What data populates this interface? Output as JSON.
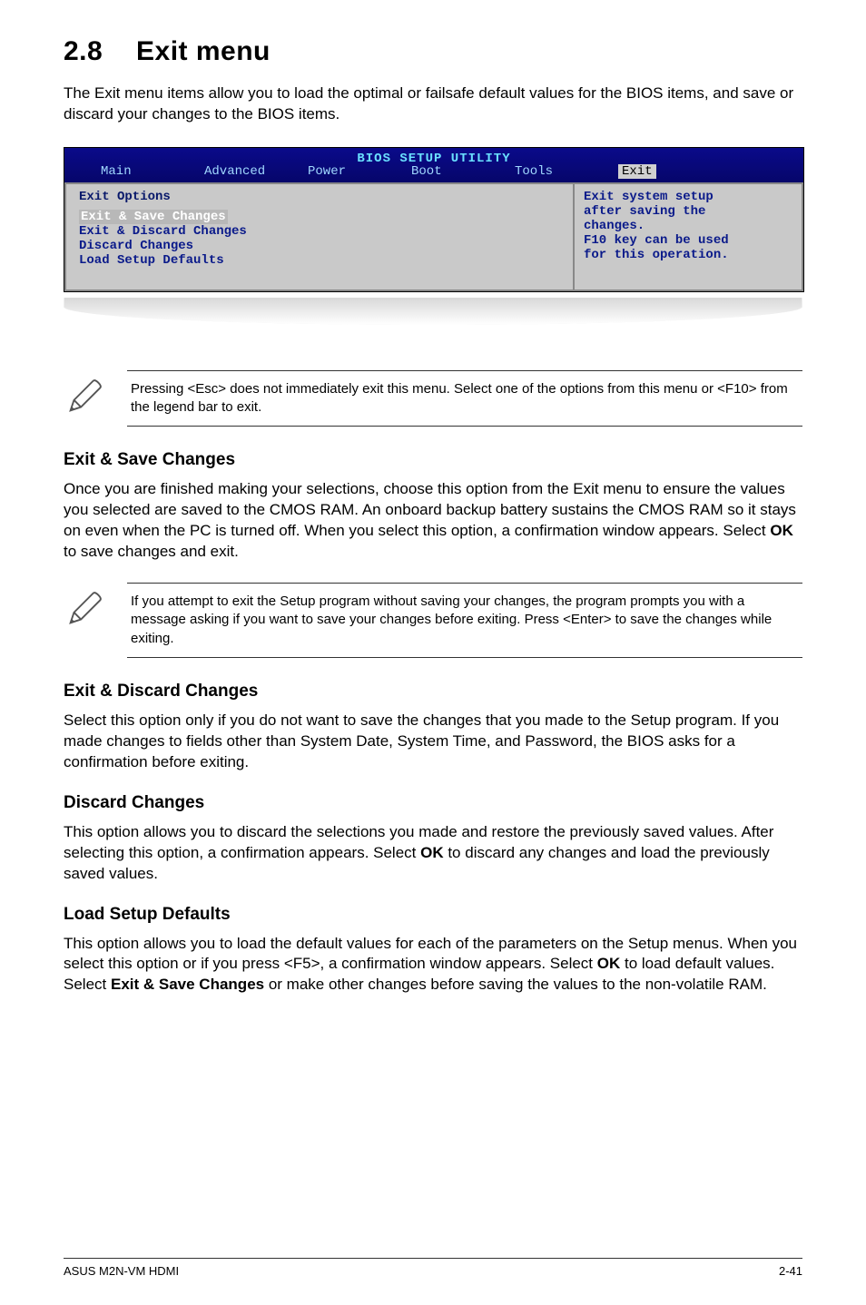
{
  "section": {
    "number": "2.8",
    "title": "Exit menu",
    "intro": "The Exit menu items allow you to load the optimal or failsafe default values for the BIOS items, and save or discard your changes to the BIOS items."
  },
  "bios": {
    "title": "BIOS SETUP UTILITY",
    "tabs": [
      "Main",
      "Advanced",
      "Power",
      "Boot",
      "Tools",
      "Exit"
    ],
    "active_tab": "Exit",
    "left_heading": "Exit Options",
    "left_items": [
      "Exit & Save Changes",
      "Exit & Discard Changes",
      "Discard Changes",
      "",
      "Load Setup Defaults"
    ],
    "right_lines": [
      "Exit system setup",
      "after saving the",
      "changes.",
      "",
      "F10 key can be used",
      "for this operation."
    ]
  },
  "note1": "Pressing <Esc> does not immediately exit this menu. Select one of the options from this menu or <F10> from the legend bar to exit.",
  "sub_exit_save": {
    "heading": "Exit & Save Changes",
    "body_pre": "Once you are finished making your selections, choose this option from the Exit menu to ensure the values you selected are saved to the CMOS RAM. An onboard backup battery sustains the CMOS RAM so it stays on even when the PC is turned off. When you select this option, a confirmation window appears. Select ",
    "body_bold": "OK",
    "body_post": " to save changes and exit."
  },
  "note2": " If you attempt to exit the Setup program without saving your changes, the program prompts you with a message asking if you want to save your changes before exiting. Press <Enter>  to save the  changes while exiting.",
  "sub_exit_discard": {
    "heading": "Exit & Discard Changes",
    "body": "Select this option only if you do not want to save the changes that you  made to the Setup program. If you made changes to fields other than System Date, System Time, and Password, the BIOS asks for a confirmation before exiting."
  },
  "sub_discard": {
    "heading": "Discard Changes",
    "body_pre": "This option allows you to discard the selections you made and restore the previously saved values. After selecting this option, a confirmation appears. Select ",
    "body_bold": "OK",
    "body_post": " to discard any changes and load the previously saved values."
  },
  "sub_load": {
    "heading": "Load Setup Defaults",
    "body_pre": "This option allows you to load the default values for each of the parameters on the Setup menus. When you select this option or if you press <F5>, a confirmation window appears. Select ",
    "body_mid_b1": "OK",
    "body_mid": " to load default values. Select ",
    "body_mid_b2": "Exit & Save Changes",
    "body_post": " or make other changes before saving the values to the non-volatile RAM."
  },
  "footer": {
    "left": "ASUS M2N-VM HDMI",
    "right": "2-41"
  }
}
